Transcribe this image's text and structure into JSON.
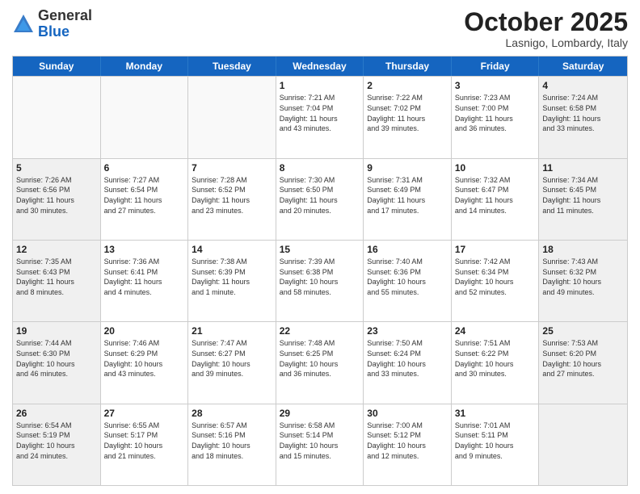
{
  "logo": {
    "general": "General",
    "blue": "Blue"
  },
  "header": {
    "month": "October 2025",
    "location": "Lasnigo, Lombardy, Italy"
  },
  "weekdays": [
    "Sunday",
    "Monday",
    "Tuesday",
    "Wednesday",
    "Thursday",
    "Friday",
    "Saturday"
  ],
  "rows": [
    [
      {
        "day": "",
        "info": "",
        "empty": true
      },
      {
        "day": "",
        "info": "",
        "empty": true
      },
      {
        "day": "",
        "info": "",
        "empty": true
      },
      {
        "day": "1",
        "info": "Sunrise: 7:21 AM\nSunset: 7:04 PM\nDaylight: 11 hours\nand 43 minutes.",
        "empty": false
      },
      {
        "day": "2",
        "info": "Sunrise: 7:22 AM\nSunset: 7:02 PM\nDaylight: 11 hours\nand 39 minutes.",
        "empty": false
      },
      {
        "day": "3",
        "info": "Sunrise: 7:23 AM\nSunset: 7:00 PM\nDaylight: 11 hours\nand 36 minutes.",
        "empty": false
      },
      {
        "day": "4",
        "info": "Sunrise: 7:24 AM\nSunset: 6:58 PM\nDaylight: 11 hours\nand 33 minutes.",
        "empty": false,
        "shaded": true
      }
    ],
    [
      {
        "day": "5",
        "info": "Sunrise: 7:26 AM\nSunset: 6:56 PM\nDaylight: 11 hours\nand 30 minutes.",
        "empty": false,
        "shaded": true
      },
      {
        "day": "6",
        "info": "Sunrise: 7:27 AM\nSunset: 6:54 PM\nDaylight: 11 hours\nand 27 minutes.",
        "empty": false
      },
      {
        "day": "7",
        "info": "Sunrise: 7:28 AM\nSunset: 6:52 PM\nDaylight: 11 hours\nand 23 minutes.",
        "empty": false
      },
      {
        "day": "8",
        "info": "Sunrise: 7:30 AM\nSunset: 6:50 PM\nDaylight: 11 hours\nand 20 minutes.",
        "empty": false
      },
      {
        "day": "9",
        "info": "Sunrise: 7:31 AM\nSunset: 6:49 PM\nDaylight: 11 hours\nand 17 minutes.",
        "empty": false
      },
      {
        "day": "10",
        "info": "Sunrise: 7:32 AM\nSunset: 6:47 PM\nDaylight: 11 hours\nand 14 minutes.",
        "empty": false
      },
      {
        "day": "11",
        "info": "Sunrise: 7:34 AM\nSunset: 6:45 PM\nDaylight: 11 hours\nand 11 minutes.",
        "empty": false,
        "shaded": true
      }
    ],
    [
      {
        "day": "12",
        "info": "Sunrise: 7:35 AM\nSunset: 6:43 PM\nDaylight: 11 hours\nand 8 minutes.",
        "empty": false,
        "shaded": true
      },
      {
        "day": "13",
        "info": "Sunrise: 7:36 AM\nSunset: 6:41 PM\nDaylight: 11 hours\nand 4 minutes.",
        "empty": false
      },
      {
        "day": "14",
        "info": "Sunrise: 7:38 AM\nSunset: 6:39 PM\nDaylight: 11 hours\nand 1 minute.",
        "empty": false
      },
      {
        "day": "15",
        "info": "Sunrise: 7:39 AM\nSunset: 6:38 PM\nDaylight: 10 hours\nand 58 minutes.",
        "empty": false
      },
      {
        "day": "16",
        "info": "Sunrise: 7:40 AM\nSunset: 6:36 PM\nDaylight: 10 hours\nand 55 minutes.",
        "empty": false
      },
      {
        "day": "17",
        "info": "Sunrise: 7:42 AM\nSunset: 6:34 PM\nDaylight: 10 hours\nand 52 minutes.",
        "empty": false
      },
      {
        "day": "18",
        "info": "Sunrise: 7:43 AM\nSunset: 6:32 PM\nDaylight: 10 hours\nand 49 minutes.",
        "empty": false,
        "shaded": true
      }
    ],
    [
      {
        "day": "19",
        "info": "Sunrise: 7:44 AM\nSunset: 6:30 PM\nDaylight: 10 hours\nand 46 minutes.",
        "empty": false,
        "shaded": true
      },
      {
        "day": "20",
        "info": "Sunrise: 7:46 AM\nSunset: 6:29 PM\nDaylight: 10 hours\nand 43 minutes.",
        "empty": false
      },
      {
        "day": "21",
        "info": "Sunrise: 7:47 AM\nSunset: 6:27 PM\nDaylight: 10 hours\nand 39 minutes.",
        "empty": false
      },
      {
        "day": "22",
        "info": "Sunrise: 7:48 AM\nSunset: 6:25 PM\nDaylight: 10 hours\nand 36 minutes.",
        "empty": false
      },
      {
        "day": "23",
        "info": "Sunrise: 7:50 AM\nSunset: 6:24 PM\nDaylight: 10 hours\nand 33 minutes.",
        "empty": false
      },
      {
        "day": "24",
        "info": "Sunrise: 7:51 AM\nSunset: 6:22 PM\nDaylight: 10 hours\nand 30 minutes.",
        "empty": false
      },
      {
        "day": "25",
        "info": "Sunrise: 7:53 AM\nSunset: 6:20 PM\nDaylight: 10 hours\nand 27 minutes.",
        "empty": false,
        "shaded": true
      }
    ],
    [
      {
        "day": "26",
        "info": "Sunrise: 6:54 AM\nSunset: 5:19 PM\nDaylight: 10 hours\nand 24 minutes.",
        "empty": false,
        "shaded": true
      },
      {
        "day": "27",
        "info": "Sunrise: 6:55 AM\nSunset: 5:17 PM\nDaylight: 10 hours\nand 21 minutes.",
        "empty": false
      },
      {
        "day": "28",
        "info": "Sunrise: 6:57 AM\nSunset: 5:16 PM\nDaylight: 10 hours\nand 18 minutes.",
        "empty": false
      },
      {
        "day": "29",
        "info": "Sunrise: 6:58 AM\nSunset: 5:14 PM\nDaylight: 10 hours\nand 15 minutes.",
        "empty": false
      },
      {
        "day": "30",
        "info": "Sunrise: 7:00 AM\nSunset: 5:12 PM\nDaylight: 10 hours\nand 12 minutes.",
        "empty": false
      },
      {
        "day": "31",
        "info": "Sunrise: 7:01 AM\nSunset: 5:11 PM\nDaylight: 10 hours\nand 9 minutes.",
        "empty": false
      },
      {
        "day": "",
        "info": "",
        "empty": true,
        "shaded": true
      }
    ]
  ]
}
